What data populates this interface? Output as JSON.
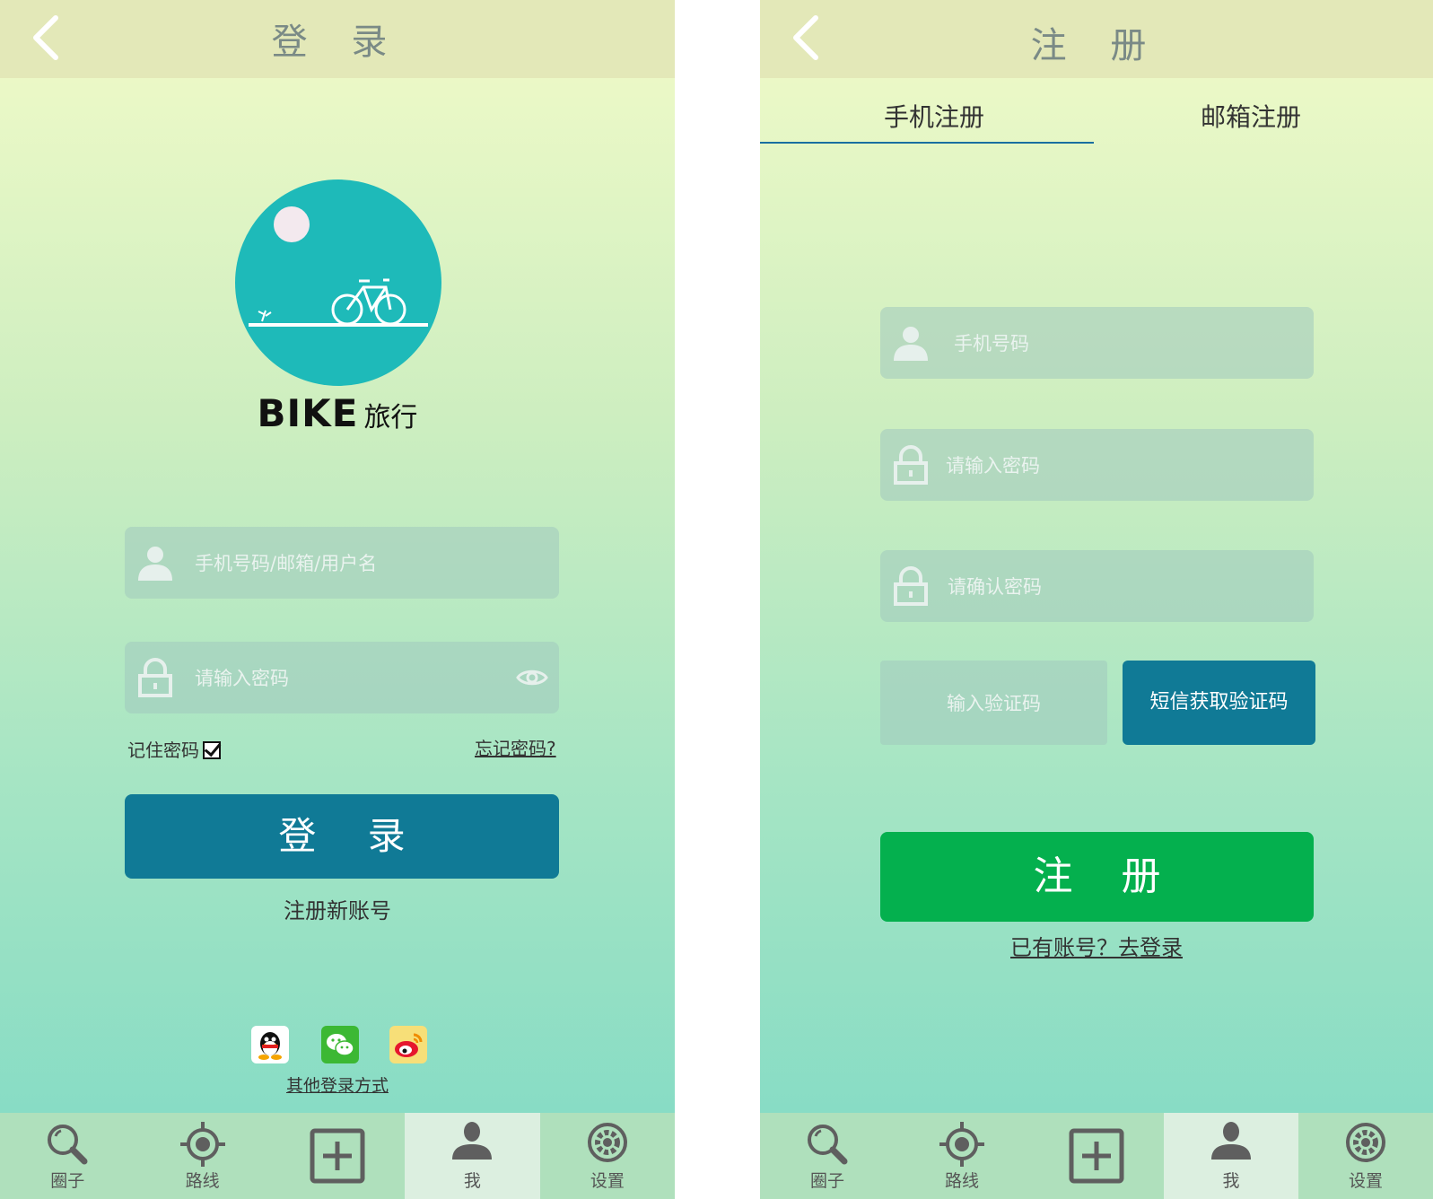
{
  "login": {
    "title": "登 录",
    "brand_bike": "BIKE",
    "brand_travel": "旅行",
    "username_placeholder": "手机号码/邮箱/用户名",
    "password_placeholder": "请输入密码",
    "remember_label": "记住密码",
    "forgot_label": "忘记密码?",
    "login_button": "登 录",
    "register_link": "注册新账号",
    "other_login": "其他登录方式",
    "social": [
      "qq-icon",
      "wechat-icon",
      "weibo-icon"
    ]
  },
  "register": {
    "title": "注 册",
    "tabs": [
      "手机注册",
      "邮箱注册"
    ],
    "phone_placeholder": "手机号码",
    "password_placeholder": "请输入密码",
    "confirm_placeholder": "请确认密码",
    "code_placeholder": "输入验证码",
    "code_button": "短信获取验证码",
    "register_button": "注 册",
    "login_link": "已有账号？去登录"
  },
  "tabbar": {
    "items": [
      {
        "label": "圈子",
        "icon": "search-icon"
      },
      {
        "label": "路线",
        "icon": "locate-icon"
      },
      {
        "label": "",
        "icon": "add-icon"
      },
      {
        "label": "我",
        "icon": "user-icon"
      },
      {
        "label": "设置",
        "icon": "gear-icon"
      }
    ],
    "active_index": 3
  },
  "colors": {
    "primary": "#107a96",
    "green": "#04b04e",
    "titlebar": "#e3e8b8",
    "logo_circle": "#1ebab9"
  }
}
